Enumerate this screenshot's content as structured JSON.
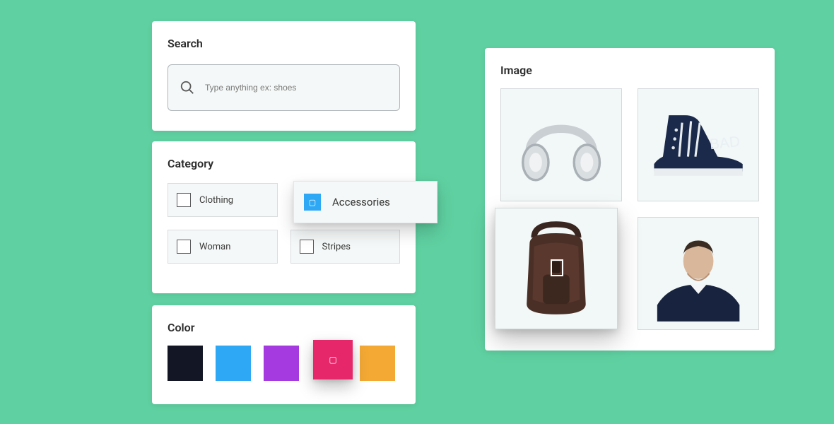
{
  "search": {
    "title": "Search",
    "placeholder": "Type anything ex: shoes"
  },
  "category": {
    "title": "Category",
    "items": [
      {
        "label": "Clothing"
      },
      {
        "label": "Accessories",
        "selected": true
      },
      {
        "label": "Woman"
      },
      {
        "label": "Stripes"
      }
    ]
  },
  "color": {
    "title": "Color",
    "swatches": [
      {
        "name": "black",
        "hex": "#131625"
      },
      {
        "name": "blue",
        "hex": "#2ea8f5"
      },
      {
        "name": "purple",
        "hex": "#a43ae0"
      },
      {
        "name": "pink",
        "hex": "#e6286a",
        "selected": true
      },
      {
        "name": "orange",
        "hex": "#f4a935"
      }
    ]
  },
  "image": {
    "title": "Image",
    "products": [
      {
        "name": "headphones"
      },
      {
        "name": "sneaker",
        "text": "BAD"
      },
      {
        "name": "backpack",
        "selected": true
      },
      {
        "name": "man-sweater"
      }
    ]
  }
}
